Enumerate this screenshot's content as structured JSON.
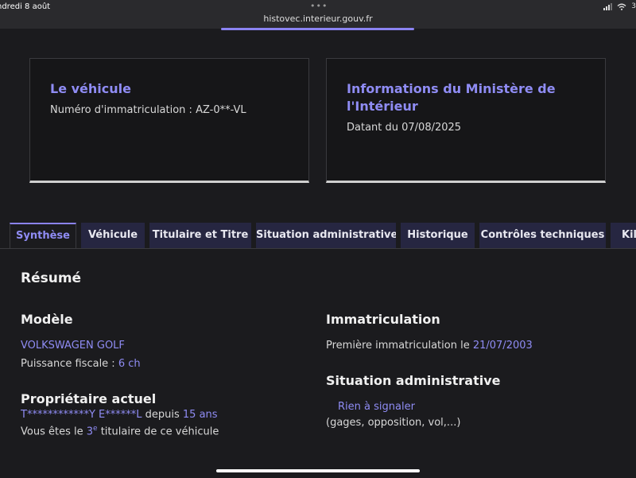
{
  "status": {
    "date": "ndredi 8 août",
    "url": "histovec.interieur.gouv.fr",
    "battery": "3"
  },
  "vehicle_card": {
    "title": "Le véhicule",
    "plate_label": "Numéro d'immatriculation : AZ-0**-VL"
  },
  "ministry_card": {
    "title_line1": "Informations du Ministère de",
    "title_line2": "l'Intérieur",
    "date_text": "Datant du 07/08/2025"
  },
  "tabs": [
    "Synthèse",
    "Véhicule",
    "Titulaire et Titre",
    "Situation administrative",
    "Historique",
    "Contrôles techniques",
    "Kil"
  ],
  "summary": {
    "title": "Résumé",
    "model_heading": "Modèle",
    "model_value": "VOLKSWAGEN GOLF",
    "fiscal_label": "Puissance fiscale :",
    "fiscal_value": "6 ch",
    "owner_heading": "Propriétaire actuel",
    "owner_name": "T************Y E******L",
    "owner_since_label": "depuis",
    "owner_since_value": "15 ans",
    "rank_prefix": "Vous êtes le",
    "rank_number": "3",
    "rank_sup": "e",
    "rank_suffix": "titulaire de ce véhicule",
    "registration_heading": "Immatriculation",
    "first_reg_label": "Première immatriculation le",
    "first_reg_date": "21/07/2003",
    "admin_heading": "Situation administrative",
    "admin_value": "Rien à signaler",
    "admin_note": "(gages, opposition, vol,...)"
  }
}
